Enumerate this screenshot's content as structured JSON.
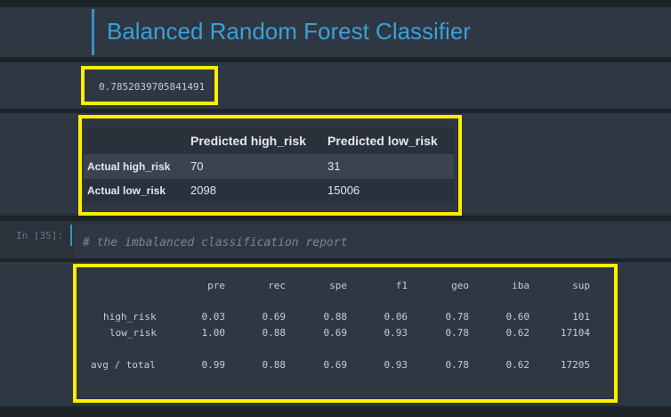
{
  "title": "Balanced Random Forest Classifier",
  "score": "0.7852039705841491",
  "confusion": {
    "headers": [
      "Predicted high_risk",
      "Predicted low_risk"
    ],
    "rows": [
      {
        "label": "Actual high_risk",
        "values": [
          "70",
          "31"
        ]
      },
      {
        "label": "Actual low_risk",
        "values": [
          "2098",
          "15006"
        ]
      }
    ]
  },
  "code_cell": {
    "prompt": "In [35]:",
    "comment": "# the imbalanced classification report"
  },
  "report": {
    "headers": [
      "pre",
      "rec",
      "spe",
      "f1",
      "geo",
      "iba",
      "sup"
    ],
    "rows": [
      {
        "label": "high_risk",
        "values": [
          "0.03",
          "0.69",
          "0.88",
          "0.06",
          "0.78",
          "0.60",
          "101"
        ]
      },
      {
        "label": "low_risk",
        "values": [
          "1.00",
          "0.88",
          "0.69",
          "0.93",
          "0.78",
          "0.62",
          "17104"
        ]
      },
      {
        "label": "avg / total",
        "values": [
          "0.99",
          "0.88",
          "0.69",
          "0.93",
          "0.78",
          "0.62",
          "17205"
        ]
      }
    ]
  },
  "colors": {
    "highlight": "#ffee00",
    "title": "#3aa0d8",
    "background": "#2b323c"
  }
}
